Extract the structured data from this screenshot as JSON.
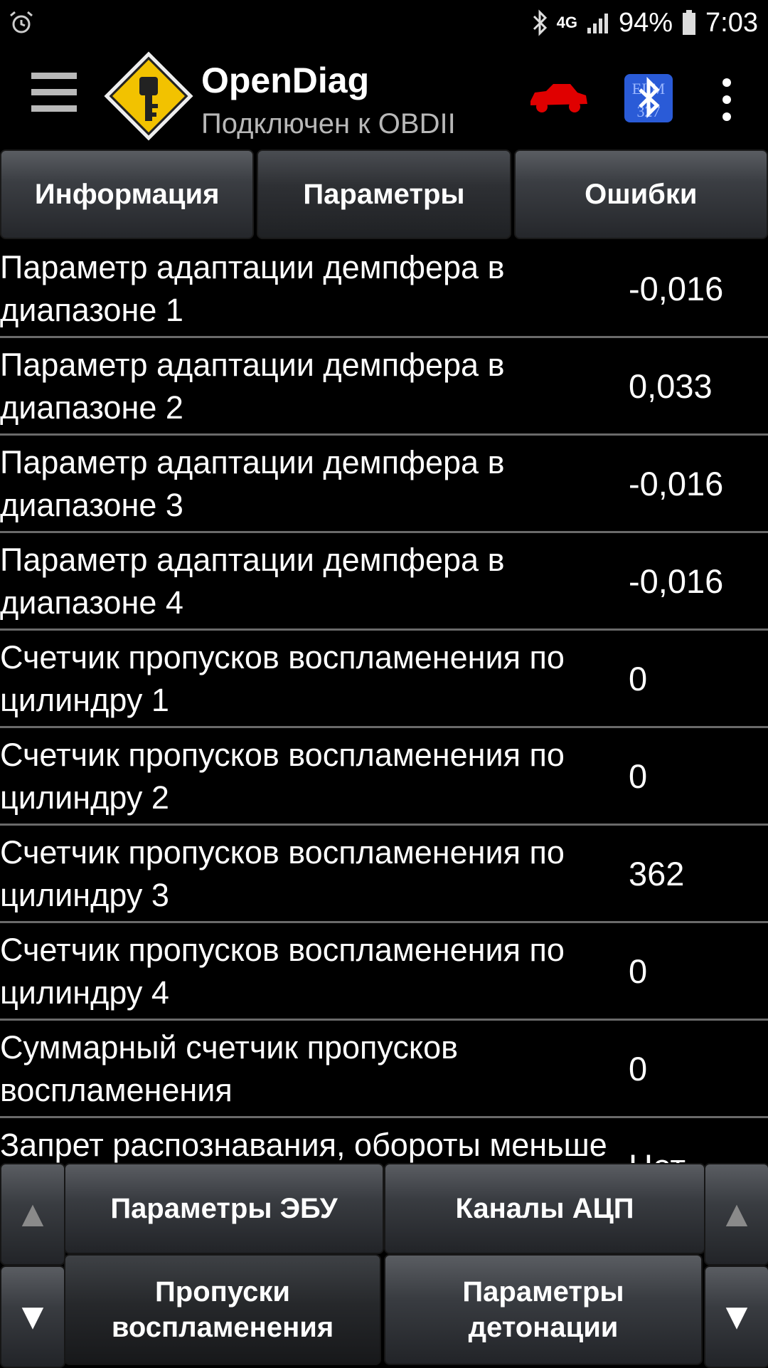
{
  "status_bar": {
    "network": "4G",
    "battery": "94%",
    "time": "7:03"
  },
  "app_bar": {
    "title": "OpenDiag",
    "subtitle": "Подключен к OBDII"
  },
  "tabs": [
    {
      "label": "Информация"
    },
    {
      "label": "Параметры"
    },
    {
      "label": "Ошибки"
    }
  ],
  "params": [
    {
      "label": "Параметр адаптации демпфера в диапазоне 1",
      "value": "-0,016"
    },
    {
      "label": "Параметр адаптации демпфера в диапазоне 2",
      "value": "0,033"
    },
    {
      "label": "Параметр адаптации демпфера в диапазоне 3",
      "value": "-0,016"
    },
    {
      "label": "Параметр адаптации демпфера в диапазоне 4",
      "value": "-0,016"
    },
    {
      "label": "Счетчик пропусков воспламенения по цилиндру 1",
      "value": "0"
    },
    {
      "label": "Счетчик пропусков воспламенения по цилиндру 2",
      "value": "0"
    },
    {
      "label": "Счетчик пропусков воспламенения по цилиндру 3",
      "value": "362"
    },
    {
      "label": "Счетчик пропусков воспламенения по цилиндру 4",
      "value": "0"
    },
    {
      "label": "Суммарный счетчик пропусков воспламенения",
      "value": "0"
    },
    {
      "label": "Запрет распознавания, обороты меньше минимальных",
      "value": "Нет"
    }
  ],
  "bottom": {
    "ecu_params": "Параметры ЭБУ",
    "adc_channels": "Каналы АЦП",
    "misfires": "Пропуски воспламенения",
    "knock_params": "Параметры детонации",
    "arrow_up": "▲",
    "arrow_down": "▼"
  },
  "colors": {
    "car_icon": "#e00000",
    "bt_badge": "#2a5bd7",
    "logo_yellow": "#f2c200"
  },
  "icons": [
    "alarm-icon",
    "bluetooth-icon",
    "signal-icon",
    "battery-icon",
    "menu-icon",
    "logo-key-icon",
    "car-icon",
    "elm327-bluetooth-icon",
    "more-vert-icon"
  ]
}
